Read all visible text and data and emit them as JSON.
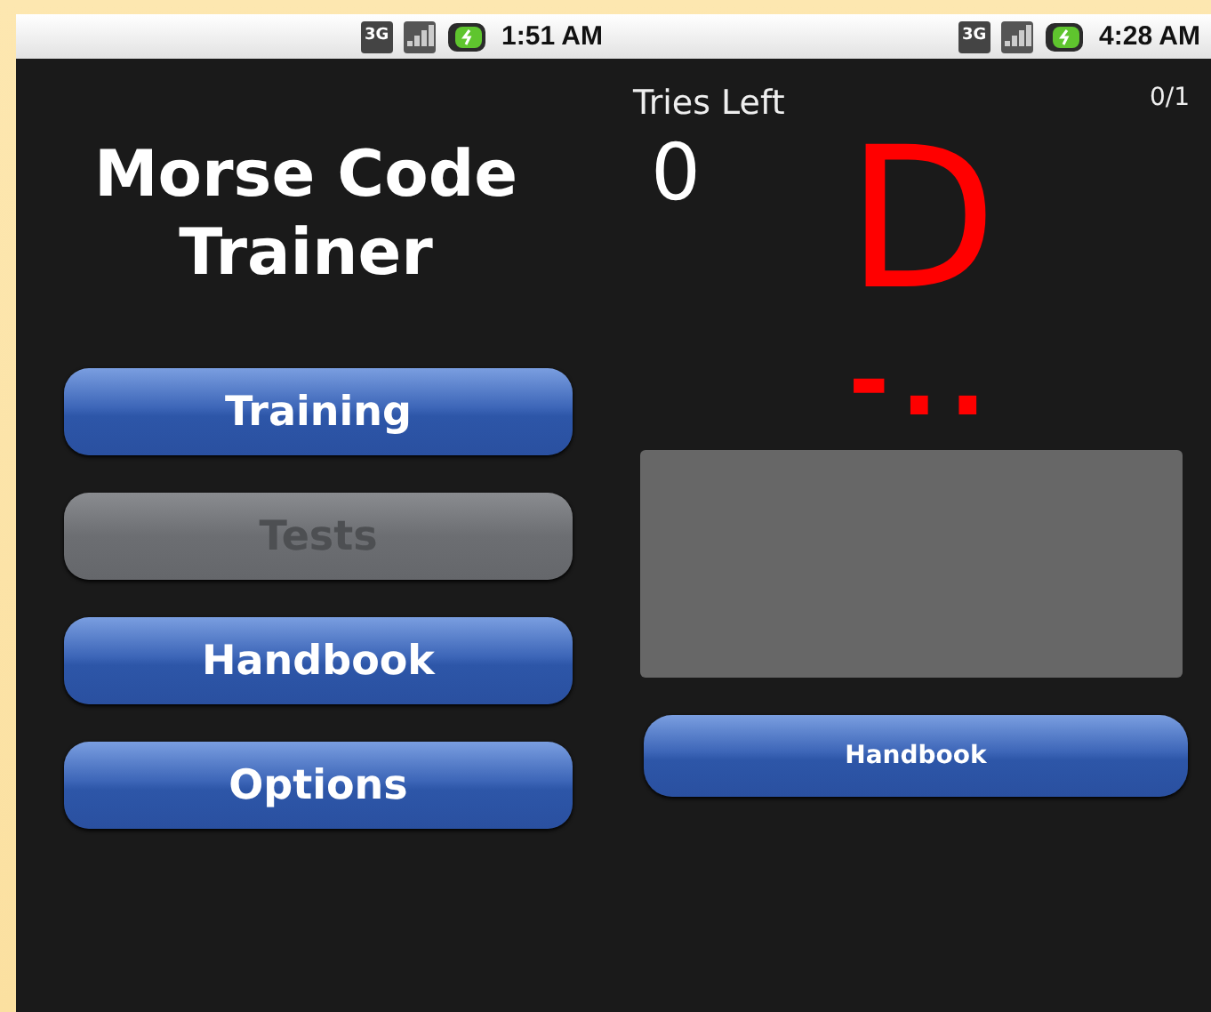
{
  "screens": [
    {
      "kind": "menu",
      "status_bar": {
        "network": "3G",
        "time": "1:51 AM"
      },
      "title": "Morse Code Trainer",
      "buttons": [
        {
          "label": "Training",
          "disabled": false
        },
        {
          "label": "Tests",
          "disabled": true
        },
        {
          "label": "Handbook",
          "disabled": false
        },
        {
          "label": "Options",
          "disabled": false
        }
      ]
    },
    {
      "kind": "quiz",
      "status_bar": {
        "network": "3G",
        "time": "4:28 AM"
      },
      "tries_label": "Tries Left",
      "tries_value": "0",
      "progress": "0/1",
      "letter": "D",
      "morse": "-..",
      "button": "Handbook"
    }
  ]
}
